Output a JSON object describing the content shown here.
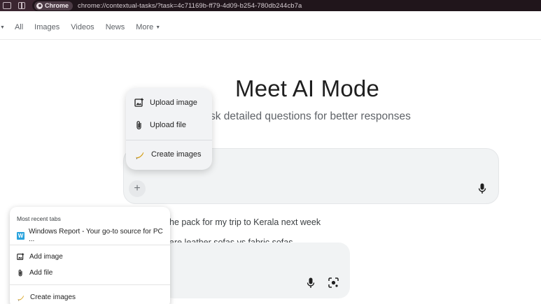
{
  "browser": {
    "chip_label": "Chrome",
    "url": "chrome://contextual-tasks/?task=4c71169b-ff79-4d09-b254-780db244cb7a"
  },
  "nav": {
    "items": [
      "All",
      "Images",
      "Videos",
      "News",
      "More"
    ]
  },
  "hero": {
    "title": "Meet AI Mode",
    "subtitle": "sk detailed questions for better responses"
  },
  "upload_menu": {
    "upload_image": "Upload image",
    "upload_file": "Upload file",
    "create_images": "Create images"
  },
  "suggestions": [
    "he pack for my trip to Kerala next week",
    "are leather sofas vs fabric sofas"
  ],
  "tabs_menu": {
    "header": "Most recent tabs",
    "recent_tab": "Windows Report - Your go-to source for PC ...",
    "add_image": "Add image",
    "add_file": "Add file",
    "create_images": "Create images"
  },
  "colors": {
    "topbar": "#3a2530",
    "input_bg": "#f1f3f4",
    "accent_w": "#29a3dd"
  }
}
